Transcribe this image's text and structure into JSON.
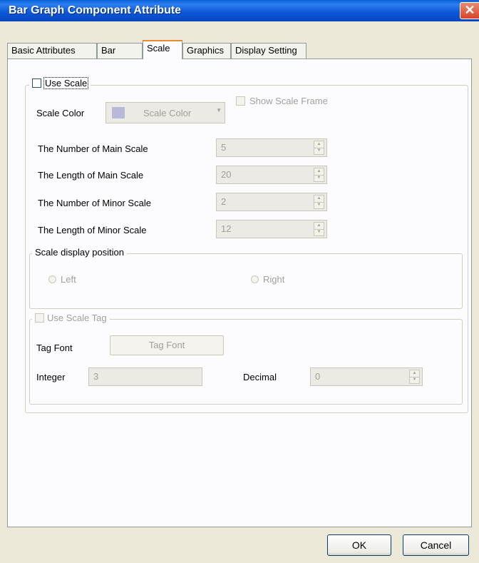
{
  "window": {
    "title": "Bar Graph Component Attribute",
    "close_glyph": "✕"
  },
  "tabs": [
    {
      "label": "Basic Attributes"
    },
    {
      "label": "Bar"
    },
    {
      "label": "Scale"
    },
    {
      "label": "Graphics"
    },
    {
      "label": "Display Setting"
    }
  ],
  "active_tab": "Scale",
  "use_scale": {
    "label": "Use Scale",
    "checked": false
  },
  "show_scale_frame": {
    "label": "Show Scale Frame",
    "checked": false
  },
  "scale_color": {
    "label": "Scale Color",
    "button_text": "Scale Color",
    "swatch_color": "#b8b9d8"
  },
  "spin_fields": [
    {
      "label": "The Number of Main Scale",
      "value": "5"
    },
    {
      "label": "The Length of Main Scale",
      "value": "20"
    },
    {
      "label": "The Number of Minor Scale",
      "value": "2"
    },
    {
      "label": "The Length of Minor Scale",
      "value": "12"
    }
  ],
  "position_group": {
    "label": "Scale display position",
    "left_label": "Left",
    "right_label": "Right"
  },
  "use_scale_tag": {
    "label": "Use Scale Tag",
    "checked": false
  },
  "tag_font": {
    "label": "Tag Font",
    "button_text": "Tag Font"
  },
  "integer": {
    "label": "Integer",
    "value": "3"
  },
  "decimal": {
    "label": "Decimal",
    "value": "0"
  },
  "buttons": {
    "ok": "OK",
    "cancel": "Cancel"
  }
}
